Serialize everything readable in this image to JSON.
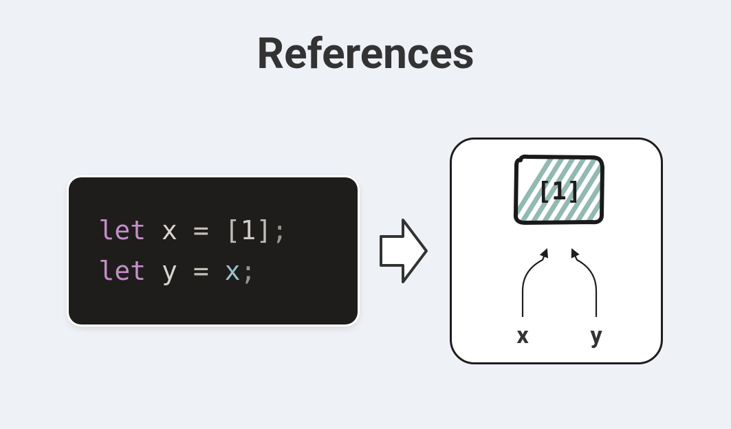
{
  "title": "References",
  "code": {
    "line1": {
      "keyword": "let",
      "name": "x",
      "eq": "=",
      "open": "[",
      "num": "1",
      "close": "]",
      "semi": ";"
    },
    "line2": {
      "keyword": "let",
      "name": "y",
      "eq": "=",
      "ref": "x",
      "semi": ";"
    }
  },
  "diagram": {
    "memoryValue": "[1]",
    "varX": "x",
    "varY": "y"
  }
}
